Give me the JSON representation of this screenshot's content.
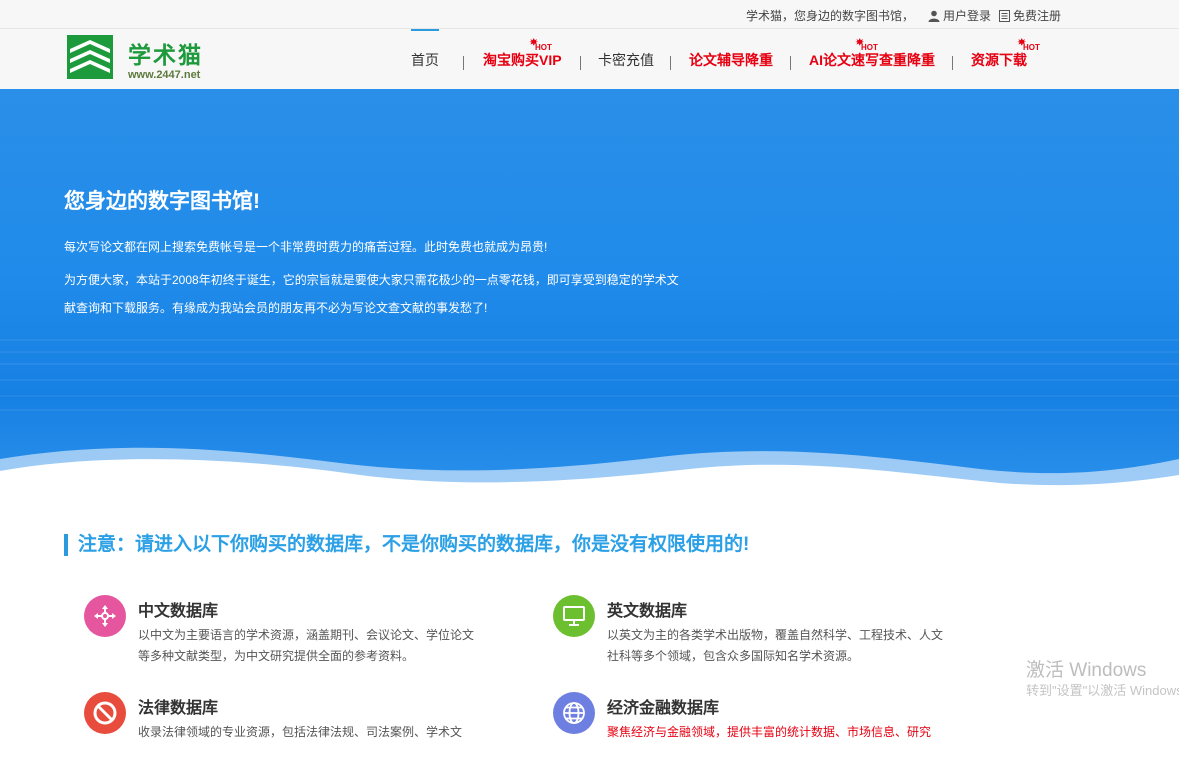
{
  "topbar": {
    "slogan": "学术猫，您身边的数字图书馆，",
    "login": "用户登录",
    "register": "免费注册"
  },
  "logo": {
    "name": "学术猫",
    "url": "www.2447.net"
  },
  "nav": {
    "items": [
      {
        "label": "首页",
        "hot": false,
        "red": false,
        "active": true
      },
      {
        "label": "淘宝购买VIP",
        "hot": true,
        "red": true,
        "active": false
      },
      {
        "label": "卡密充值",
        "hot": false,
        "red": false,
        "active": false
      },
      {
        "label": "论文辅导降重",
        "hot": false,
        "red": true,
        "active": false
      },
      {
        "label": "AI论文速写查重降重",
        "hot": true,
        "red": true,
        "active": false
      },
      {
        "label": "资源下载",
        "hot": true,
        "red": true,
        "active": false
      }
    ],
    "hot_badge": "HOT"
  },
  "hero": {
    "title": "您身边的数字图书馆!",
    "line1": "每次写论文都在网上搜索免费帐号是一个非常费时费力的痛苦过程。此时免费也就成为昂贵!",
    "line2": "为方便大家，本站于2008年初终于诞生，它的宗旨就是要使大家只需花极少的一点零花钱，即可享受到稳定的学术文",
    "line3": "献查询和下载服务。有缘成为我站会员的朋友再不必为写论文查文献的事发愁了!"
  },
  "notice": "注意：请进入以下你购买的数据库，不是你购买的数据库，你是没有权限使用的!",
  "databases": [
    {
      "title": "中文数据库",
      "desc": "以中文为主要语言的学术资源，涵盖期刊、会议论文、学位论文等多种文献类型，为中文研究提供全面的参考资料。",
      "icon": "move-arrows-icon",
      "color": "#e6569e"
    },
    {
      "title": "英文数据库",
      "desc": "以英文为主的各类学术出版物，覆盖自然科学、工程技术、人文社科等多个领域，包含众多国际知名学术资源。",
      "icon": "monitor-icon",
      "color": "#6cbf2e"
    },
    {
      "title": "法律数据库",
      "desc": "收录法律领域的专业资源，包括法律法规、司法案例、学术文",
      "icon": "prohibited-icon",
      "color": "#e84c3d"
    },
    {
      "title": "经济金融数据库",
      "desc": "聚焦经济与金融领域，提供丰富的统计数据、市场信息、研究",
      "icon": "globe-icon",
      "color": "#6d7fe0"
    }
  ],
  "watermark": {
    "line1": "激活 Windows",
    "line2": "转到\"设置\"以激活 Windows。"
  }
}
